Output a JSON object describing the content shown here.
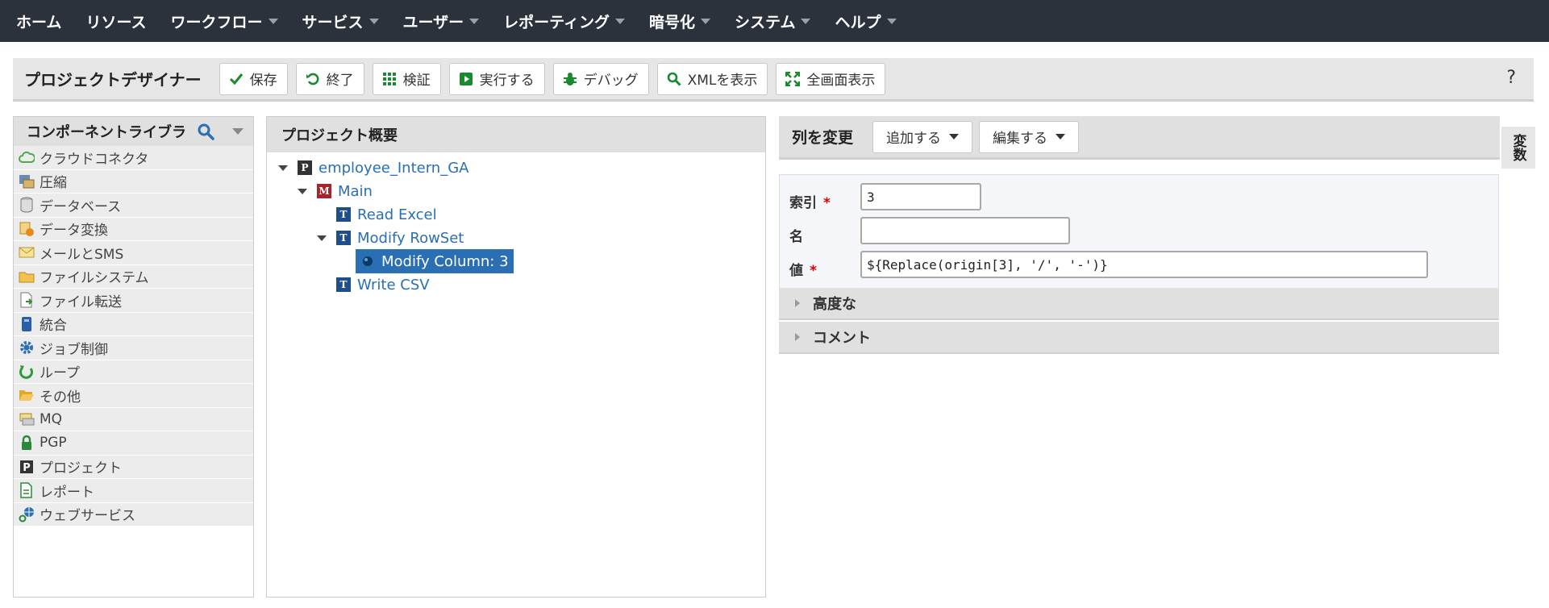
{
  "nav": {
    "items": [
      {
        "label": "ホーム",
        "caret": false
      },
      {
        "label": "リソース",
        "caret": false
      },
      {
        "label": "ワークフロー",
        "caret": true
      },
      {
        "label": "サービス",
        "caret": true
      },
      {
        "label": "ユーザー",
        "caret": true
      },
      {
        "label": "レポーティング",
        "caret": true
      },
      {
        "label": "暗号化",
        "caret": true
      },
      {
        "label": "システム",
        "caret": true
      },
      {
        "label": "ヘルプ",
        "caret": true
      }
    ]
  },
  "toolbar": {
    "title": "プロジェクトデザイナー",
    "buttons": [
      {
        "label": "保存",
        "icon": "check-icon"
      },
      {
        "label": "終了",
        "icon": "undo-icon"
      },
      {
        "label": "検証",
        "icon": "grid-icon"
      },
      {
        "label": "実行する",
        "icon": "play-icon"
      },
      {
        "label": "デバッグ",
        "icon": "bug-icon"
      },
      {
        "label": "XMLを表示",
        "icon": "magnifier-icon"
      },
      {
        "label": "全画面表示",
        "icon": "expand-icon"
      }
    ],
    "help": "?"
  },
  "library": {
    "title": "コンポーネントライブラリ",
    "items": [
      {
        "label": "クラウドコネクタ",
        "icon": "cloud-icon"
      },
      {
        "label": "圧縮",
        "icon": "compress-icon"
      },
      {
        "label": "データベース",
        "icon": "database-icon"
      },
      {
        "label": "データ変換",
        "icon": "transform-icon"
      },
      {
        "label": "メールとSMS",
        "icon": "mail-icon"
      },
      {
        "label": "ファイルシステム",
        "icon": "folder-icon"
      },
      {
        "label": "ファイル転送",
        "icon": "file-transfer-icon"
      },
      {
        "label": "統合",
        "icon": "integration-icon"
      },
      {
        "label": "ジョブ制御",
        "icon": "gear-icon"
      },
      {
        "label": "ループ",
        "icon": "loop-icon"
      },
      {
        "label": "その他",
        "icon": "open-folder-icon"
      },
      {
        "label": "MQ",
        "icon": "mq-icon"
      },
      {
        "label": "PGP",
        "icon": "lock-icon"
      },
      {
        "label": "プロジェクト",
        "icon": "project-icon"
      },
      {
        "label": "レポート",
        "icon": "report-icon"
      },
      {
        "label": "ウェブサービス",
        "icon": "web-service-icon"
      }
    ]
  },
  "project": {
    "title": "プロジェクト概要",
    "tree": [
      {
        "label": "employee_Intern_GA",
        "badge": "P",
        "badge_color": "#333333",
        "toggle": true,
        "selected": false
      },
      {
        "label": "Main",
        "badge": "M",
        "badge_color": "#a8242b",
        "toggle": true,
        "selected": false
      },
      {
        "label": "Read Excel",
        "badge": "T",
        "badge_color": "#1f4e8c",
        "toggle": false,
        "selected": false
      },
      {
        "label": "Modify RowSet",
        "badge": "T",
        "badge_color": "#1f4e8c",
        "toggle": true,
        "selected": false
      },
      {
        "label": "Modify Column: 3",
        "badge": "",
        "badge_color": "#0b3a66",
        "toggle": false,
        "selected": true
      },
      {
        "label": "Write CSV",
        "badge": "T",
        "badge_color": "#1f4e8c",
        "toggle": false,
        "selected": false
      }
    ]
  },
  "editor": {
    "title": "列を変更",
    "add_label": "追加する",
    "edit_label": "編集する",
    "side_tab": "変数",
    "fields": {
      "index": {
        "label": "索引",
        "required": "*",
        "value": "3"
      },
      "name": {
        "label": "名",
        "value": ""
      },
      "value": {
        "label": "値",
        "required": "*",
        "value": "${Replace(origin[3], '/', '-')}"
      }
    },
    "sections": [
      "高度な",
      "コメント"
    ]
  },
  "colors": {
    "nav_bg": "#2b323c",
    "link": "#2a6fb3",
    "selected_bg": "#2a6fb3",
    "required": "#dd0000",
    "icon_green": "#1a8a2e"
  }
}
